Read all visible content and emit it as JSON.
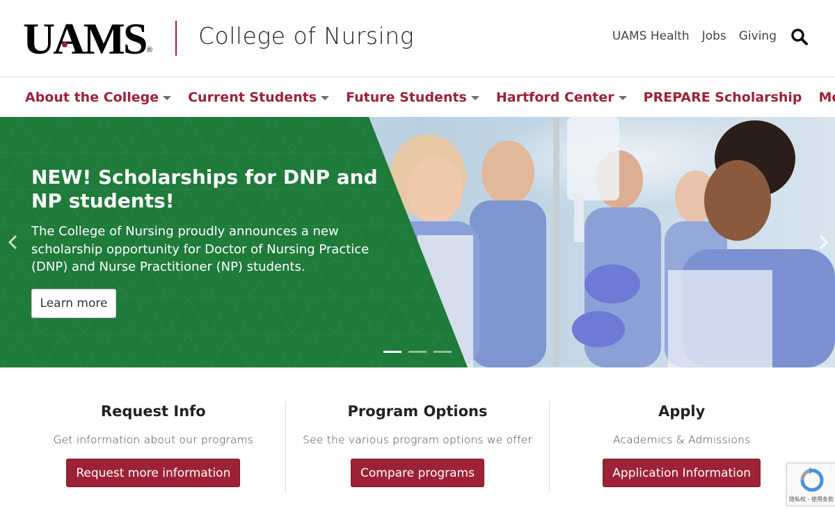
{
  "header": {
    "logo_text": "UAMS",
    "logo_reg": "®",
    "college_name": "College of Nursing",
    "utility_links": [
      "UAMS Health",
      "Jobs",
      "Giving"
    ],
    "search_icon": "search-icon"
  },
  "nav": {
    "items": [
      {
        "label": "About the College",
        "dropdown": true
      },
      {
        "label": "Current Students",
        "dropdown": true
      },
      {
        "label": "Future Students",
        "dropdown": true
      },
      {
        "label": "Hartford Center",
        "dropdown": true
      },
      {
        "label": "PREPARE Scholarship",
        "dropdown": false
      },
      {
        "label": "More",
        "dropdown": true
      }
    ]
  },
  "hero": {
    "title": "NEW! Scholarships for DNP and NP students!",
    "body": "The College of Nursing proudly announces a new scholarship opportunity for Doctor of Nursing Practice (DNP) and Nurse Practitioner (NP) students.",
    "button_label": "Learn more",
    "slide_count": 3,
    "active_slide": 1,
    "green_color": "#1e7b3a"
  },
  "cards": [
    {
      "title": "Request Info",
      "text": "Get information about our programs",
      "button": "Request more information"
    },
    {
      "title": "Program Options",
      "text": "See the various program options we offer",
      "button": "Compare programs"
    },
    {
      "title": "Apply",
      "text": "Academics & Admissions",
      "button": "Application Information"
    }
  ],
  "recaptcha": {
    "label": "隐私权 - 使用条款"
  },
  "colors": {
    "brand": "#9d2235",
    "hero_green": "#1e7b3a"
  }
}
